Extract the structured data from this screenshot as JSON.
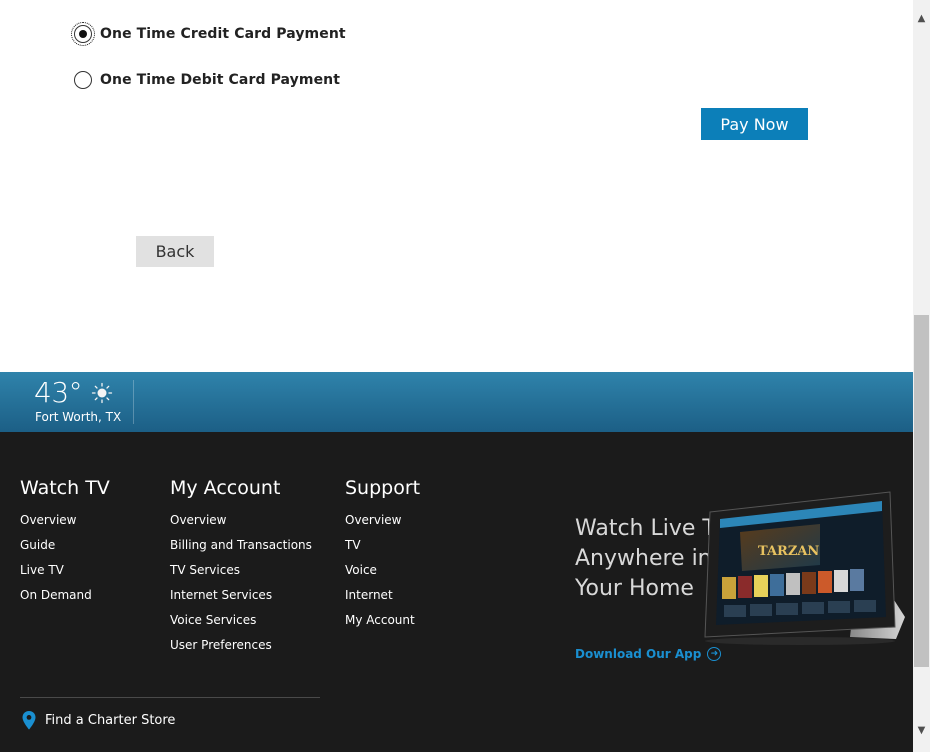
{
  "payment": {
    "options": [
      {
        "label": "One Time Credit Card Payment",
        "selected": true
      },
      {
        "label": "One Time Debit Card Payment",
        "selected": false
      }
    ],
    "pay_now_label": "Pay Now",
    "back_label": "Back"
  },
  "weather": {
    "temperature": "43°",
    "location": "Fort Worth, TX",
    "icon": "sun-icon"
  },
  "footer": {
    "watch_tv": {
      "heading": "Watch TV",
      "links": [
        "Overview",
        "Guide",
        "Live TV",
        "On Demand"
      ]
    },
    "my_account": {
      "heading": "My Account",
      "links": [
        "Overview",
        "Billing and Transactions",
        "TV Services",
        "Internet Services",
        "Voice Services",
        "User Preferences"
      ]
    },
    "support": {
      "heading": "Support",
      "links": [
        "Overview",
        "TV",
        "Voice",
        "Internet",
        "My Account"
      ]
    },
    "store_link": "Find a Charter Store",
    "promo": {
      "title": "Watch Live TV Anywhere in Your Home",
      "link": "Download Our App",
      "tablet_title": "TARZAN"
    }
  },
  "colors": {
    "accent": "#0c7fb9",
    "weather_bar": "#2f83ab",
    "footer_bg": "#1b1b1b",
    "link_blue": "#1a8fd0"
  }
}
